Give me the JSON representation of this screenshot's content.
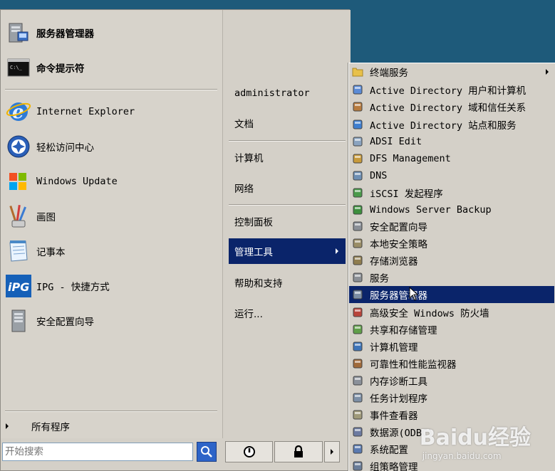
{
  "left_pane": {
    "pinned": [
      {
        "label": "服务器管理器",
        "icon": "server-manager-icon"
      },
      {
        "label": "命令提示符",
        "icon": "command-prompt-icon"
      }
    ],
    "recent": [
      {
        "label": "Internet Explorer",
        "icon": "internet-explorer-icon"
      },
      {
        "label": "轻松访问中心",
        "icon": "ease-of-access-icon"
      },
      {
        "label": "Windows Update",
        "icon": "windows-update-icon"
      },
      {
        "label": "画图",
        "icon": "paint-icon"
      },
      {
        "label": "记事本",
        "icon": "notepad-icon"
      },
      {
        "label": "IPG - 快捷方式",
        "icon": "ipg-icon"
      },
      {
        "label": "安全配置向导",
        "icon": "security-wizard-icon"
      }
    ],
    "all_programs": "所有程序"
  },
  "right_pane": {
    "items": [
      {
        "label": "administrator"
      },
      {
        "label": "文档"
      },
      {
        "label": "计算机"
      },
      {
        "label": "网络"
      },
      {
        "label": "控制面板"
      },
      {
        "label": "管理工具",
        "active": true
      },
      {
        "label": "帮助和支持"
      },
      {
        "label": "运行..."
      }
    ]
  },
  "search": {
    "placeholder": "开始搜索"
  },
  "submenu": {
    "items": [
      {
        "label": "终端服务",
        "has_submenu": true
      },
      {
        "label": "Active Directory 用户和计算机"
      },
      {
        "label": "Active Directory 域和信任关系"
      },
      {
        "label": "Active Directory 站点和服务"
      },
      {
        "label": "ADSI Edit"
      },
      {
        "label": "DFS Management"
      },
      {
        "label": "DNS"
      },
      {
        "label": "iSCSI 发起程序"
      },
      {
        "label": "Windows Server Backup"
      },
      {
        "label": "安全配置向导"
      },
      {
        "label": "本地安全策略"
      },
      {
        "label": "存储浏览器"
      },
      {
        "label": "服务"
      },
      {
        "label": "服务器管理器",
        "highlighted": true
      },
      {
        "label": "高级安全 Windows 防火墙"
      },
      {
        "label": "共享和存储管理"
      },
      {
        "label": "计算机管理"
      },
      {
        "label": "可靠性和性能监视器"
      },
      {
        "label": "内存诊断工具"
      },
      {
        "label": "任务计划程序"
      },
      {
        "label": "事件查看器"
      },
      {
        "label": "数据源(ODBC)"
      },
      {
        "label": "系统配置"
      },
      {
        "label": "组策略管理"
      }
    ]
  },
  "watermark": {
    "brand": "Baidu经验",
    "url": "jingyan.baidu.com"
  },
  "colors": {
    "menu_bg": "#d4d0c8",
    "highlight": "#0a246a",
    "desktop": "#1e5a7a"
  }
}
